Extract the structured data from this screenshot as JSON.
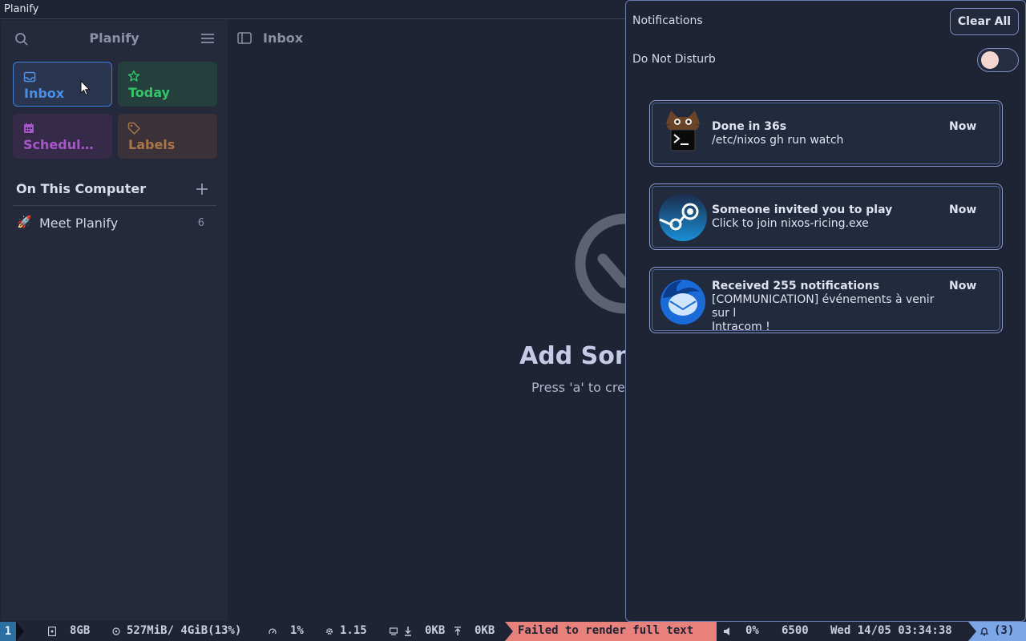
{
  "window": {
    "title": "Planify"
  },
  "sidebar": {
    "title": "Planify",
    "cards": {
      "inbox": "Inbox",
      "today": "Today",
      "scheduled": "Schedul…",
      "labels": "Labels"
    },
    "section_title": "On This Computer",
    "projects": [
      {
        "emoji": "🚀",
        "name": "Meet Planify",
        "count": "6"
      }
    ]
  },
  "main": {
    "title": "Inbox",
    "empty_title": "Add Son",
    "empty_subtitle": "Press 'a' to cre"
  },
  "notifications": {
    "title": "Notifications",
    "clear_label": "Clear All",
    "dnd_label": "Do Not Disturb",
    "dnd_on": false,
    "items": [
      {
        "app_icon": "terminal-cat-icon",
        "summary": "Done in 36s",
        "body": "/etc/nixos gh run watch",
        "time": "Now"
      },
      {
        "app_icon": "steam-icon",
        "summary": "Someone invited you to play",
        "body": "Click to join nixos-ricing.exe",
        "time": "Now"
      },
      {
        "app_icon": "thunderbird-icon",
        "summary": "Received 255 notifications",
        "body": "[COMMUNICATION] événements à venir sur l\nIntracom !",
        "time": "Now"
      }
    ]
  },
  "statusbar": {
    "workspace": "1",
    "disk": "8GB",
    "memory": "527MiB/ 4GiB(13%)",
    "cpu": "1%",
    "load": "1.15",
    "net_down": "0KB",
    "net_up": "0KB",
    "error": "Failed to render full text",
    "volume": "0%",
    "temperature": "6500",
    "clock": "Wed 14/05 03:34:38",
    "notif_count": "(3)",
    "colors": {
      "workspace": "#2a6fa0",
      "error": "#e8807c",
      "notif": "#7ba7e8"
    }
  }
}
